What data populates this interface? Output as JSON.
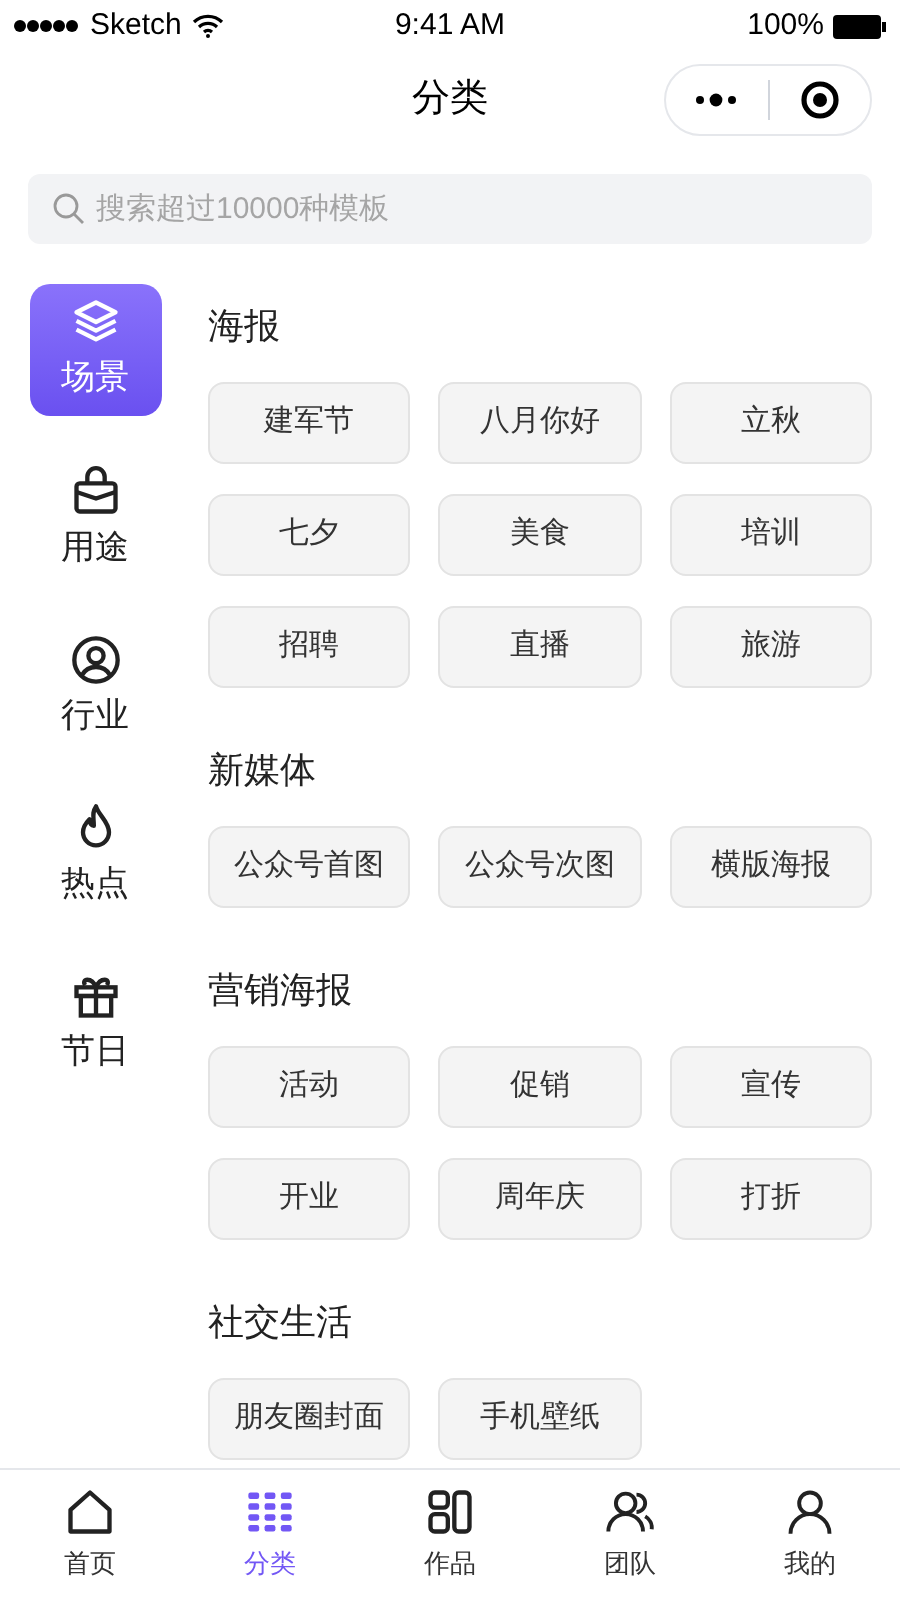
{
  "status_bar": {
    "carrier": "Sketch",
    "time": "9:41 AM",
    "battery": "100%"
  },
  "header": {
    "title": "分类"
  },
  "search": {
    "placeholder": "搜索超过10000种模板"
  },
  "sidebar": {
    "items": [
      {
        "label": "场景",
        "kind": "layers",
        "selected": true
      },
      {
        "label": "用途",
        "kind": "bag",
        "selected": false
      },
      {
        "label": "行业",
        "kind": "person",
        "selected": false
      },
      {
        "label": "热点",
        "kind": "flame",
        "selected": false
      },
      {
        "label": "节日",
        "kind": "gift",
        "selected": false
      }
    ]
  },
  "sections": [
    {
      "title": "海报",
      "tags": [
        "建军节",
        "八月你好",
        "立秋",
        "七夕",
        "美食",
        "培训",
        "招聘",
        "直播",
        "旅游"
      ]
    },
    {
      "title": "新媒体",
      "tags": [
        "公众号首图",
        "公众号次图",
        "横版海报"
      ]
    },
    {
      "title": "营销海报",
      "tags": [
        "活动",
        "促销",
        "宣传",
        "开业",
        "周年庆",
        "打折"
      ]
    },
    {
      "title": "社交生活",
      "tags": [
        "朋友圈封面",
        "手机壁纸"
      ]
    }
  ],
  "tab_bar": [
    {
      "label": "首页",
      "kind": "home",
      "selected": false
    },
    {
      "label": "分类",
      "kind": "grid",
      "selected": true
    },
    {
      "label": "作品",
      "kind": "works",
      "selected": false
    },
    {
      "label": "团队",
      "kind": "team",
      "selected": false
    },
    {
      "label": "我的",
      "kind": "user",
      "selected": false
    }
  ]
}
